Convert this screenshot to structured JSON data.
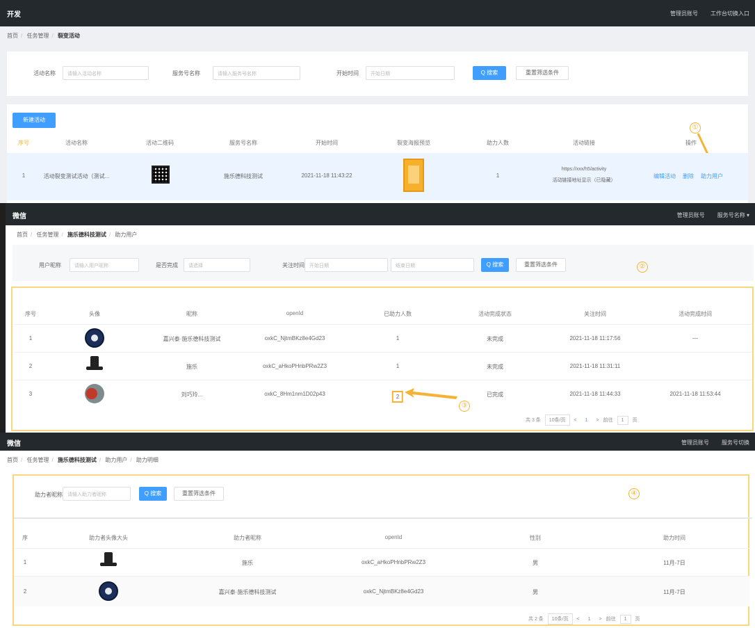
{
  "panel1": {
    "topbar": {
      "brand": "开发",
      "right_items": [
        "管理员账号",
        "工作台切换入口"
      ]
    },
    "breadcrumb": [
      "首页",
      "任务管理",
      "裂变活动"
    ],
    "filters": [
      {
        "label": "活动名称",
        "placeholder": "请输入活动名称"
      },
      {
        "label": "服务号名称",
        "placeholder": "请输入服务号名称"
      },
      {
        "label": "开始时间",
        "placeholder": "开始日期"
      }
    ],
    "search_button": "Q 搜索",
    "reset_button": "重置筛选条件",
    "create_button": "新建活动",
    "table_headers": [
      "序号",
      "活动名称",
      "活动二维码",
      "服务号名称",
      "开始时间",
      "裂变海报预览",
      "助力人数",
      "活动链接",
      "操作"
    ],
    "rows": [
      {
        "index": "1",
        "name": "活动裂变测试活动（测试...",
        "account": "施乐德科技测试",
        "start_time": "2021-11-18 11:43:22",
        "helpers": "1",
        "link_line1": "https://xxx/h5/activity",
        "link_line2": "活动链接地址显示（已隐藏）",
        "actions": [
          "编辑活动",
          "删除",
          "助力用户"
        ]
      }
    ],
    "step_marker": "①"
  },
  "panel2": {
    "topbar": {
      "brand": "微信",
      "right_items": [
        "管理员账号",
        "服务号名称 ▾"
      ]
    },
    "breadcrumb": [
      "首页",
      "任务管理",
      "施乐德科技测试",
      "助力用户"
    ],
    "filters": [
      {
        "label": "用户昵称",
        "placeholder": "请输入用户昵称"
      },
      {
        "label": "是否完成",
        "placeholder": "请选择"
      },
      {
        "label": "关注时间",
        "placeholder": "开始日期"
      },
      {
        "label": "",
        "placeholder": "结束日期"
      }
    ],
    "search_button": "Q 搜索",
    "reset_button": "重置筛选条件",
    "table_headers": [
      "序号",
      "头像",
      "昵称",
      "openId",
      "已助力人数",
      "活动完成状态",
      "关注时间",
      "活动完成时间"
    ],
    "rows": [
      {
        "index": "1",
        "avatar": "seal",
        "nickname": "嘉兴泰·施乐德科技测试",
        "openid": "oxkC_NjtmBKz8e4Gd23",
        "count": "1",
        "status": "未完成",
        "follow_time": "2021-11-18 11:17:56",
        "done_time": "—"
      },
      {
        "index": "2",
        "avatar": "hat",
        "nickname": "施乐",
        "openid": "oxkC_aHkoPHnbPRw2Z3",
        "count": "1",
        "status": "未完成",
        "follow_time": "2021-11-18 11:31:11",
        "done_time": ""
      },
      {
        "index": "3",
        "avatar": "photo",
        "nickname": "刘巧玲...",
        "openid": "oxkC_8Hm1nm1D02p43",
        "count": "2",
        "status": "已完成",
        "follow_time": "2021-11-18 11:44:33",
        "done_time": "2021-11-18 11:53:44"
      }
    ],
    "pager": {
      "total": "共 3 条",
      "size": "10条/页",
      "pages": [
        "<",
        "1",
        ">"
      ],
      "goto": "前往",
      "goto_page": "1",
      "suffix": "页"
    },
    "step_markers": [
      "②",
      "③"
    ]
  },
  "panel3": {
    "topbar": {
      "brand": "微信",
      "right_items": [
        "管理员账号",
        "服务号切换"
      ]
    },
    "breadcrumb": [
      "首页",
      "任务管理",
      "施乐德科技测试",
      "助力用户",
      "助力明细"
    ],
    "filters": [
      {
        "label": "助力者昵称",
        "placeholder": "请输入助力者昵称"
      }
    ],
    "search_button": "Q 搜索",
    "reset_button": "重置筛选条件",
    "table_headers": [
      "序",
      "助力者头像大头",
      "助力者昵称",
      "openId",
      "性别",
      "助力时间"
    ],
    "rows": [
      {
        "index": "1",
        "avatar": "hat",
        "nickname": "施乐",
        "openid": "oxkC_aHkoPHnbPRw2Z3",
        "gender": "男",
        "time": "11月-7日"
      },
      {
        "index": "2",
        "avatar": "seal",
        "nickname": "嘉兴泰·施乐德科技测试",
        "openid": "oxkC_NjtmBKz8e4Gd23",
        "gender": "男",
        "time": "11月-7日"
      }
    ],
    "pager": {
      "total": "共 2 条",
      "size": "10条/页",
      "pages": [
        "<",
        "1",
        ">"
      ],
      "goto": "前往",
      "goto_page": "1",
      "suffix": "页"
    },
    "step_marker": "④"
  },
  "colors": {
    "primary": "#409eff",
    "topbar": "#24292e",
    "highlight": "#f7d77e",
    "arrow": "#f5b335"
  }
}
